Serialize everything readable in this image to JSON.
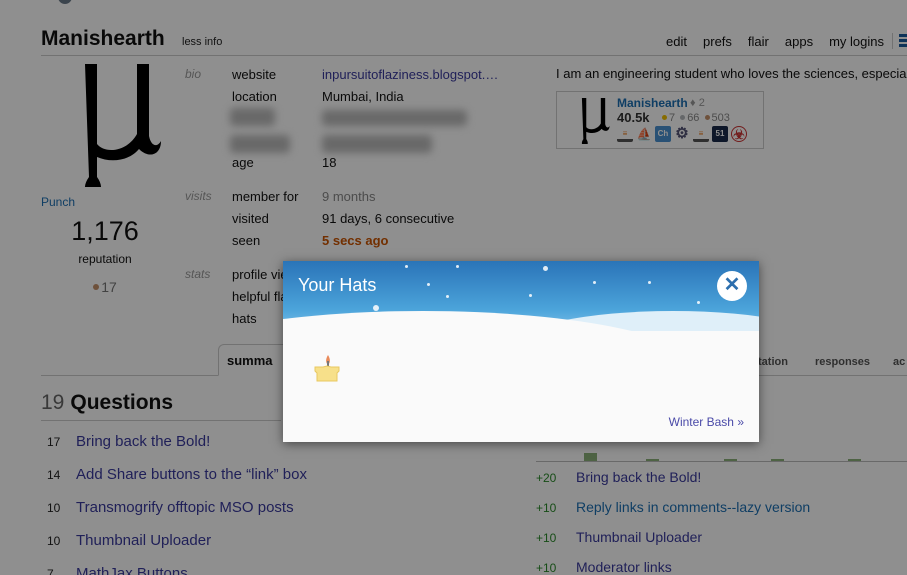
{
  "header": {
    "user_name": "Manishearth",
    "less_info": "less info",
    "links": [
      "edit",
      "prefs",
      "flair",
      "apps",
      "my logins"
    ],
    "menu_icon": "hamburger-menu-icon"
  },
  "profile": {
    "avatar_icon": "mu-letter-avatar",
    "display_link": "Punch",
    "reputation": "1,176",
    "reputation_label": "reputation",
    "bronze_badges": "17"
  },
  "bio": {
    "section_label": "bio",
    "website_label": "website",
    "website_value": "inpursuitoflaziness.blogspot.…",
    "location_label": "location",
    "location_value": "Mumbai, India",
    "age_label": "age",
    "age_value": "18"
  },
  "visits": {
    "section_label": "visits",
    "member_for_label": "member for",
    "member_for_value": "9 months",
    "visited_label": "visited",
    "visited_value": "91 days, 6 consecutive",
    "seen_label": "seen",
    "seen_value": "5 secs ago"
  },
  "stats": {
    "section_label": "stats",
    "profile_views_label": "profile vie",
    "helpful_flags_label": "helpful fla",
    "hats_label": "hats"
  },
  "about_me": "I am an engineering student who loves the sciences, especiall",
  "flair": {
    "name": "Manishearth",
    "moderator_count": "2",
    "reputation": "40.5k",
    "gold": "7",
    "silver": "66",
    "bronze": "503",
    "site_icons": [
      "stackoverflow-icon",
      "sailing-icon",
      "chemistry-icon",
      "settings-icon",
      "stackoverflow-icon",
      "area51-icon",
      "biohazard-icon"
    ],
    "area51_label": "51",
    "chem_label": "Ch"
  },
  "tabs": {
    "summary": "summa",
    "reputation": "tation",
    "responses": "responses",
    "activity": "ac"
  },
  "questions": {
    "count": "19",
    "title": "Questions",
    "items": [
      {
        "score": "17",
        "title": "Bring back the Bold!"
      },
      {
        "score": "14",
        "title": "Add Share buttons to the “link” box"
      },
      {
        "score": "10",
        "title": "Transmogrify offtopic MSO posts"
      },
      {
        "score": "10",
        "title": "Thumbnail Uploader"
      },
      {
        "score": "7",
        "title": "MathJax Buttons"
      }
    ]
  },
  "reputation_changes": {
    "items": [
      {
        "delta": "+20",
        "title": "Bring back the Bold!"
      },
      {
        "delta": "+10",
        "title": "Reply links in comments--lazy version"
      },
      {
        "delta": "+10",
        "title": "Thumbnail Uploader"
      },
      {
        "delta": "+10",
        "title": "Moderator links"
      }
    ]
  },
  "hats_modal": {
    "title": "Your Hats",
    "close_icon": "close-icon",
    "hat_icon": "candle-hat-icon",
    "footer_link": "Winter Bash »"
  }
}
